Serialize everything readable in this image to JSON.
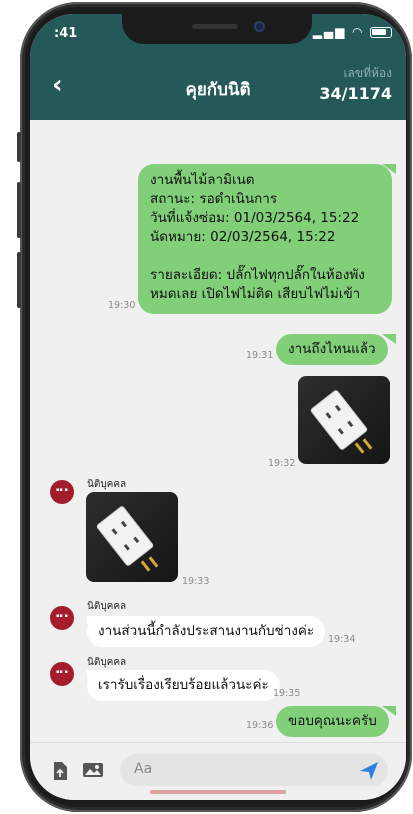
{
  "status": {
    "time": ":41",
    "signal": "..ıl",
    "wifi": "wifi"
  },
  "header": {
    "title": "คุยกับนิติ",
    "room_label": "เลขที่ห้อง",
    "room_number": "34/1174",
    "back_icon": "chevron-left-icon"
  },
  "messages": {
    "m1": {
      "lines": [
        "งานพื้นไม้ลามิเนต",
        "สถานะ: รอดำเนินการ",
        "วันที่แจ้งซ่อม: 01/03/2564, 15:22",
        "นัดหมาย: 02/03/2564, 15:22",
        "",
        "รายละเอียด: ปลั๊กไฟทุกปลั๊กในห้องพัง",
        "หมดเลย เปิดไฟไม่ติด เสียบไฟไม่เข้า"
      ],
      "time": "19:30"
    },
    "m2": {
      "text": "งานถึงไหนแล้ว",
      "time": "19:31"
    },
    "m3": {
      "time": "19:32"
    },
    "m4": {
      "sender": "นิติบุคคล",
      "time": "19:33"
    },
    "m5": {
      "sender": "นิติบุคคล",
      "text": "งานส่วนนี้กำลังประสานงานกับช่างค่ะ",
      "time": "19:34"
    },
    "m6": {
      "sender": "นิติบุคคล",
      "text": "เรารับเรื่องเรียบร้อยแล้วนะค่ะ",
      "time": "19:35"
    },
    "m7": {
      "text": "ขอบคุณนะครับ",
      "time": "19:36"
    }
  },
  "input": {
    "placeholder": "Aa",
    "send_icon": "send-icon",
    "file_icon": "file-upload-icon",
    "image_icon": "image-icon"
  },
  "colors": {
    "header": "#255858",
    "outgoing": "#82cf7a",
    "incoming": "#ffffff",
    "avatar": "#a51c2c",
    "send": "#2f7fe0"
  }
}
